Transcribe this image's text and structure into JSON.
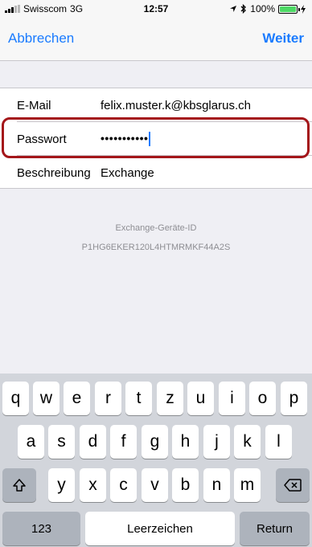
{
  "status_bar": {
    "carrier": "Swisscom",
    "network": "3G",
    "time": "12:57",
    "battery_percent": "100%",
    "battery_level": 1.0,
    "icons": [
      "signal-icon",
      "location-arrow-icon",
      "bluetooth-icon",
      "battery-icon",
      "charging-icon"
    ]
  },
  "nav": {
    "cancel_label": "Abbrechen",
    "next_label": "Weiter"
  },
  "form": {
    "email_label": "E-Mail",
    "email_value": "felix.muster.k@kbsglarus.ch",
    "password_label": "Passwort",
    "password_value": "•••••••••••",
    "description_label": "Beschreibung",
    "description_value": "Exchange"
  },
  "device": {
    "label": "Exchange-Geräte-ID",
    "value": "P1HG6EKER120L4HTMRMKF44A2S"
  },
  "keyboard": {
    "row1": [
      "q",
      "w",
      "e",
      "r",
      "t",
      "z",
      "u",
      "i",
      "o",
      "p"
    ],
    "row2": [
      "a",
      "s",
      "d",
      "f",
      "g",
      "h",
      "j",
      "k",
      "l"
    ],
    "row3": [
      "y",
      "x",
      "c",
      "v",
      "b",
      "n",
      "m"
    ],
    "numbers_label": "123",
    "space_label": "Leerzeichen",
    "return_label": "Return",
    "shift_icon": "shift-icon",
    "delete_icon": "backspace-icon"
  },
  "colors": {
    "accent": "#1a7bff",
    "highlight_border": "#a4161a",
    "battery": "#4cd964"
  }
}
